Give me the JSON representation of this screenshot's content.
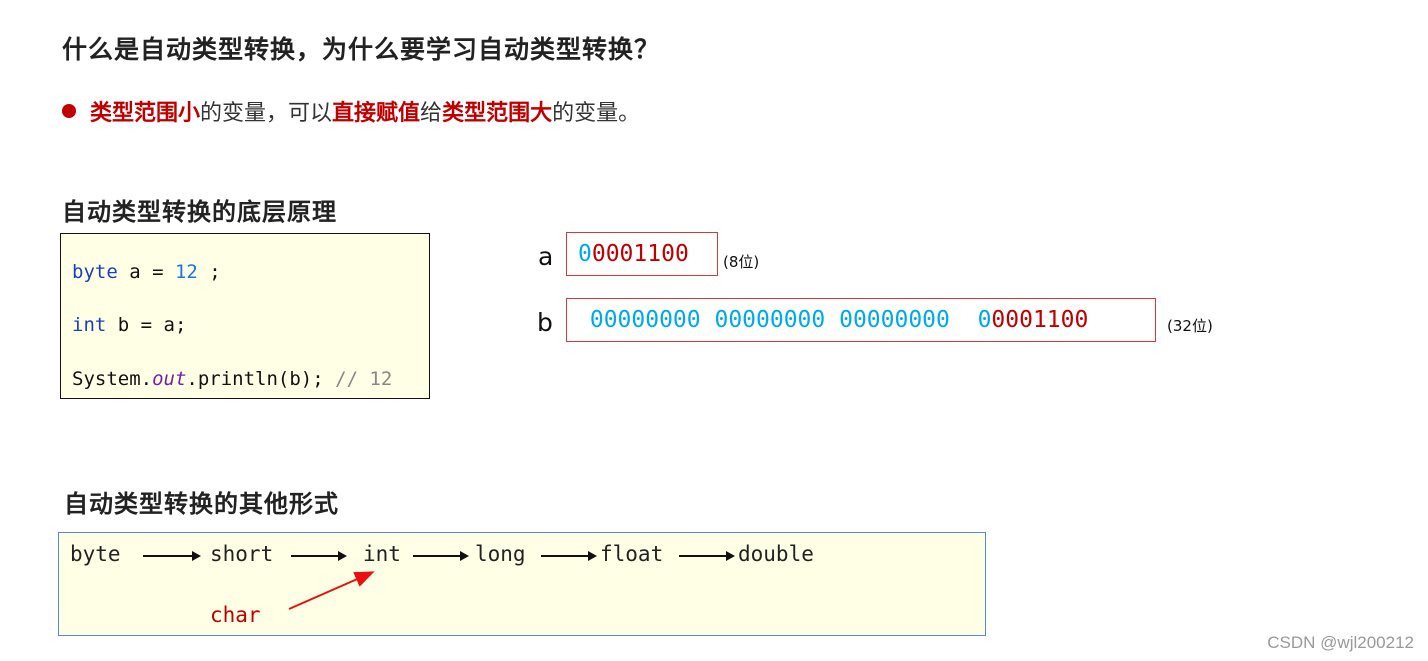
{
  "heading": "什么是自动类型转换，为什么要学习自动类型转换？",
  "bullet": {
    "part1": "类型范围小",
    "part2": "的变量，可以",
    "part3": "直接赋值",
    "part4": "给",
    "part5": "类型范围大",
    "part6": "的变量。"
  },
  "section1": {
    "title": "自动类型转换的底层原理",
    "code": {
      "line1": {
        "kw": "byte",
        "rest1": " a = ",
        "num": "12",
        "rest2": " ;"
      },
      "line2": {
        "kw": "int",
        "rest": " b = a;"
      },
      "line3": {
        "pre": "System.",
        "field": "out",
        "post": ".println(b); ",
        "comment": "// 12"
      }
    },
    "var_a": {
      "label": "a",
      "bits_blue": "0",
      "bits_red": "0001100",
      "note": "(8位)"
    },
    "var_b": {
      "label": "b",
      "bits_blue": " 00000000 00000000 00000000  0",
      "bits_red": "0001100",
      "note": "(32位)"
    }
  },
  "section2": {
    "title": "自动类型转换的其他形式",
    "chain": [
      "byte",
      "short",
      "int",
      "long",
      "float",
      "double"
    ],
    "side": "char"
  },
  "watermark": "CSDN @wjl200212"
}
